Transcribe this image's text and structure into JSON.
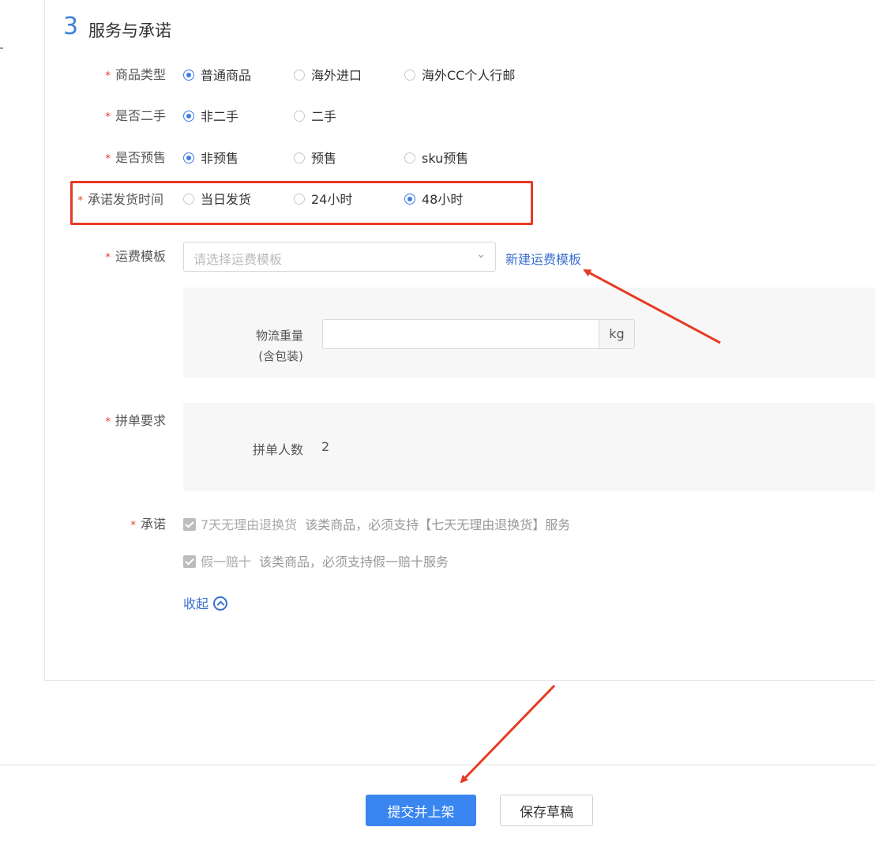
{
  "section": {
    "number": "3",
    "title": "服务与承诺"
  },
  "product_type": {
    "label": "商品类型",
    "options": [
      "普通商品",
      "海外进口",
      "海外CC个人行邮"
    ],
    "selected": 0
  },
  "second_hand": {
    "label": "是否二手",
    "options": [
      "非二手",
      "二手"
    ],
    "selected": 0
  },
  "presale": {
    "label": "是否预售",
    "options": [
      "非预售",
      "预售",
      "sku预售"
    ],
    "selected": 0
  },
  "ship_time": {
    "label": "承诺发货时间",
    "options": [
      "当日发货",
      "24小时",
      "48小时"
    ],
    "selected": 2
  },
  "freight": {
    "label": "运费模板",
    "placeholder": "请选择运费模板",
    "new_link": "新建运费模板"
  },
  "weight": {
    "label_line1": "物流重量",
    "label_line2": "(含包装)",
    "unit": "kg",
    "value": ""
  },
  "group": {
    "label": "拼单要求",
    "count_label": "拼单人数",
    "count_value": "2"
  },
  "promise": {
    "label": "承诺",
    "items": [
      {
        "name": "7天无理由退换货",
        "desc": "该类商品，必须支持【七天无理由退换货】服务"
      },
      {
        "name": "假一赔十",
        "desc": "该类商品，必须支持假一赔十服务"
      }
    ],
    "collapse_label": "收起"
  },
  "footer": {
    "submit_label": "提交并上架",
    "draft_label": "保存草稿"
  },
  "colors": {
    "accent": "#3a86f0",
    "link": "#3b6fcf",
    "highlight": "#e83a22",
    "required": "#e5391c"
  }
}
